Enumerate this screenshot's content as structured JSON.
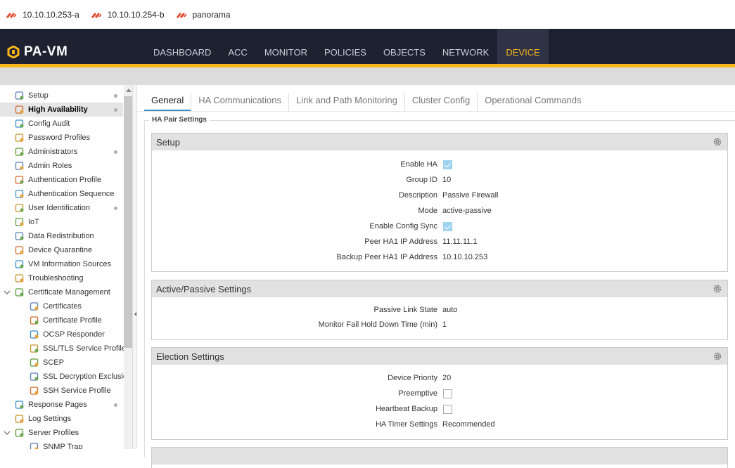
{
  "bookmarks": [
    {
      "label": "10.10.10.253-a",
      "icon": "paloalto-icon"
    },
    {
      "label": "10.10.10.254-b",
      "icon": "paloalto-icon"
    },
    {
      "label": "panorama",
      "icon": "paloalto-icon"
    }
  ],
  "brand": {
    "name": "PA-VM"
  },
  "nav": {
    "tabs": [
      "DASHBOARD",
      "ACC",
      "MONITOR",
      "POLICIES",
      "OBJECTS",
      "NETWORK",
      "DEVICE"
    ],
    "active": "DEVICE"
  },
  "sidebar": {
    "items": [
      {
        "label": "Setup",
        "dot": true
      },
      {
        "label": "High Availability",
        "dot": true,
        "selected": true
      },
      {
        "label": "Config Audit"
      },
      {
        "label": "Password Profiles"
      },
      {
        "label": "Administrators",
        "dot": true
      },
      {
        "label": "Admin Roles"
      },
      {
        "label": "Authentication Profile"
      },
      {
        "label": "Authentication Sequence"
      },
      {
        "label": "User Identification",
        "dot": true
      },
      {
        "label": "IoT"
      },
      {
        "label": "Data Redistribution"
      },
      {
        "label": "Device Quarantine"
      },
      {
        "label": "VM Information Sources"
      },
      {
        "label": "Troubleshooting"
      },
      {
        "label": "Certificate Management",
        "expanded": true
      },
      {
        "label": "Certificates",
        "child": true
      },
      {
        "label": "Certificate Profile",
        "child": true
      },
      {
        "label": "OCSP Responder",
        "child": true
      },
      {
        "label": "SSL/TLS Service Profile",
        "child": true
      },
      {
        "label": "SCEP",
        "child": true
      },
      {
        "label": "SSL Decryption Exclusio",
        "child": true
      },
      {
        "label": "SSH Service Profile",
        "child": true
      },
      {
        "label": "Response Pages",
        "dot": true
      },
      {
        "label": "Log Settings"
      },
      {
        "label": "Server Profiles",
        "expanded": true
      },
      {
        "label": "SNMP Trap",
        "child": true
      }
    ]
  },
  "subtabs": [
    "General",
    "HA Communications",
    "Link and Path Monitoring",
    "Cluster Config",
    "Operational Commands"
  ],
  "subtab_active": "General",
  "fieldset_legend": "HA Pair Settings",
  "setup": {
    "title": "Setup",
    "enable_ha_label": "Enable HA",
    "enable_ha": true,
    "group_id_label": "Group ID",
    "group_id": "10",
    "description_label": "Description",
    "description": "Passive Firewall",
    "mode_label": "Mode",
    "mode": "active-passive",
    "enable_config_sync_label": "Enable Config Sync",
    "enable_config_sync": true,
    "peer_ha1_label": "Peer HA1 IP Address",
    "peer_ha1": "11.11.11.1",
    "backup_peer_ha1_label": "Backup Peer HA1 IP Address",
    "backup_peer_ha1": "10.10.10.253"
  },
  "active_passive": {
    "title": "Active/Passive Settings",
    "passive_link_state_label": "Passive Link State",
    "passive_link_state": "auto",
    "monitor_fail_label": "Monitor Fail Hold Down Time (min)",
    "monitor_fail": "1"
  },
  "election": {
    "title": "Election Settings",
    "device_priority_label": "Device Priority",
    "device_priority": "20",
    "preemptive_label": "Preemptive",
    "preemptive": false,
    "heartbeat_backup_label": "Heartbeat Backup",
    "heartbeat_backup": false,
    "ha_timer_label": "HA Timer Settings",
    "ha_timer": "Recommended"
  },
  "colors": {
    "accent": "#fab71b",
    "header": "#1e2230",
    "tab_underline": "#3a8ec8",
    "checkbox": "#9dd3ef"
  }
}
